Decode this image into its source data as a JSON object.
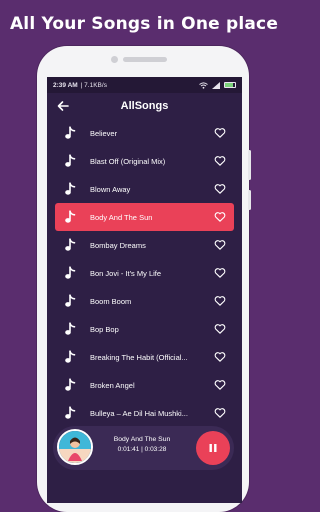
{
  "headline": "All Your Songs in One place",
  "status_bar": {
    "time": "2:39 AM",
    "speed": "| 7.1KB/s"
  },
  "app_bar": {
    "title": "AllSongs"
  },
  "songs": [
    {
      "title": "Believer"
    },
    {
      "title": "Blast Off (Original Mix)"
    },
    {
      "title": "Blown Away"
    },
    {
      "title": "Body And The Sun",
      "active": true
    },
    {
      "title": "Bombay Dreams"
    },
    {
      "title": "Bon Jovi - It's My Life"
    },
    {
      "title": "Boom Boom"
    },
    {
      "title": "Bop Bop"
    },
    {
      "title": "Breaking The Habit (Official..."
    },
    {
      "title": "Broken Angel"
    },
    {
      "title": "Bulleya – Ae Dil Hai Mushki..."
    }
  ],
  "now_playing": {
    "title": "Body And The Sun",
    "time": "0:01:41 | 0:03:28"
  },
  "colors": {
    "background": "#5a2d6e",
    "screen": "#2e1f45",
    "accent": "#ea4158"
  },
  "icons": [
    "back-arrow-icon",
    "music-note-icon",
    "heart-outline-icon",
    "pause-icon",
    "wifi-icon",
    "battery-icon"
  ]
}
